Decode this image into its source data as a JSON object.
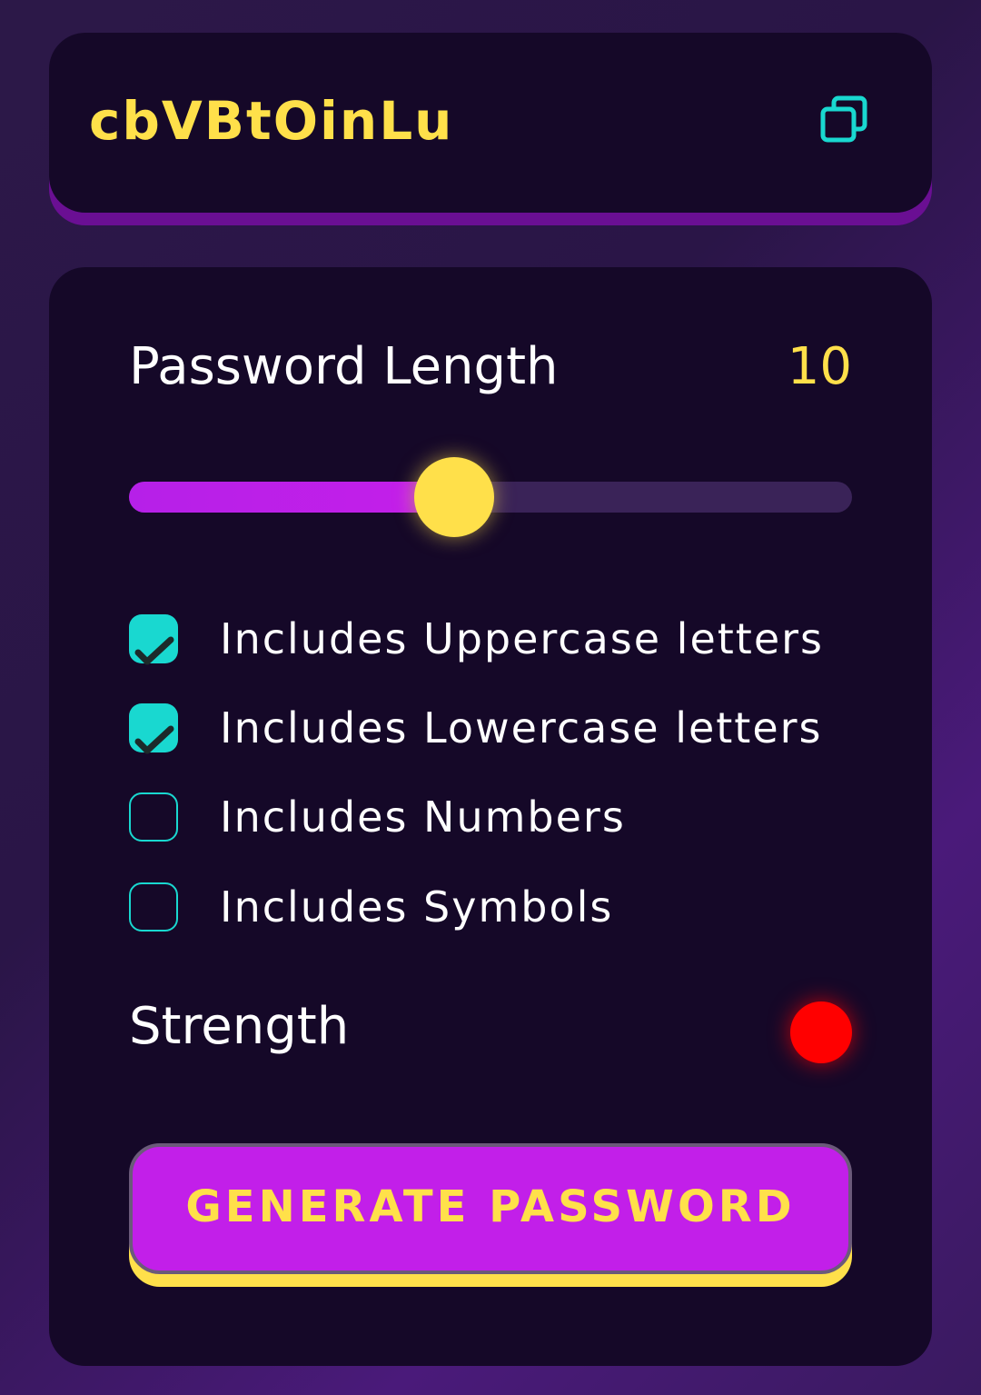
{
  "output": {
    "password": "cbVBtOinLu",
    "copy_icon": "copy-icon"
  },
  "settings": {
    "length_label": "Password Length",
    "length_value": "10",
    "slider": {
      "value": 10,
      "fill_percent": 45
    },
    "options": [
      {
        "label": "Includes Uppercase letters",
        "checked": true
      },
      {
        "label": "Includes Lowercase letters",
        "checked": true
      },
      {
        "label": "Includes Numbers",
        "checked": false
      },
      {
        "label": "Includes Symbols",
        "checked": false
      }
    ],
    "strength_label": "Strength",
    "strength_color": "#ff0000",
    "generate_label": "GENERATE PASSWORD"
  },
  "colors": {
    "accent_yellow": "#ffe04a",
    "accent_purple": "#c21fe9",
    "accent_cyan": "#19d8d0",
    "card_bg": "#150828"
  }
}
